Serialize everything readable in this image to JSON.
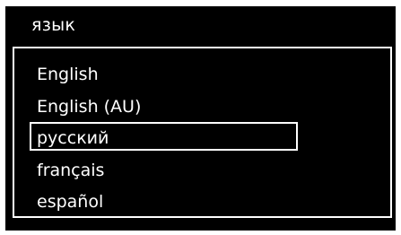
{
  "dialog": {
    "title": "язык"
  },
  "language_list": {
    "options": [
      {
        "label": "English"
      },
      {
        "label": "English (AU)"
      },
      {
        "label": "русский"
      },
      {
        "label": "français"
      },
      {
        "label": "español"
      }
    ],
    "selected_index": 2
  },
  "colors": {
    "background": "#000000",
    "foreground": "#ffffff"
  }
}
